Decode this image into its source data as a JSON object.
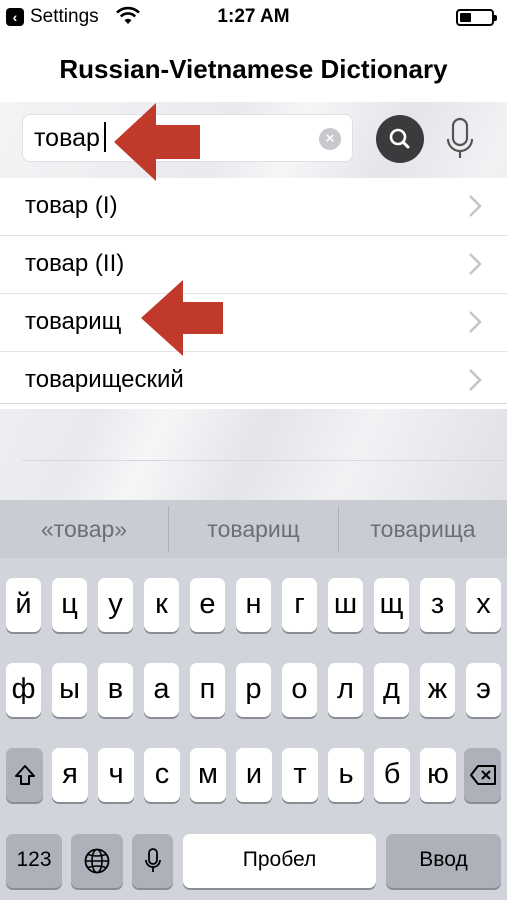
{
  "status_bar": {
    "back_label": "Settings",
    "time": "1:27 AM"
  },
  "header": {
    "title": "Russian-Vietnamese Dictionary"
  },
  "search": {
    "value": "товар"
  },
  "results": [
    {
      "label": "товар (I)"
    },
    {
      "label": "товар (II)"
    },
    {
      "label": "товарищ"
    },
    {
      "label": "товарищеский"
    }
  ],
  "keyboard": {
    "suggestions": [
      "«товар»",
      "товарищ",
      "товарища"
    ],
    "row1": [
      "й",
      "ц",
      "у",
      "к",
      "е",
      "н",
      "г",
      "ш",
      "щ",
      "з",
      "х"
    ],
    "row2": [
      "ф",
      "ы",
      "в",
      "а",
      "п",
      "р",
      "о",
      "л",
      "д",
      "ж",
      "э"
    ],
    "row3": [
      "я",
      "ч",
      "с",
      "м",
      "и",
      "т",
      "ь",
      "б",
      "ю"
    ],
    "numbers_label": "123",
    "space_label": "Пробел",
    "return_label": "Ввод"
  },
  "colors": {
    "annotation_arrow": "#c0392b",
    "search_button": "#3b3b3d",
    "keyboard_bg": "#d1d4da"
  }
}
